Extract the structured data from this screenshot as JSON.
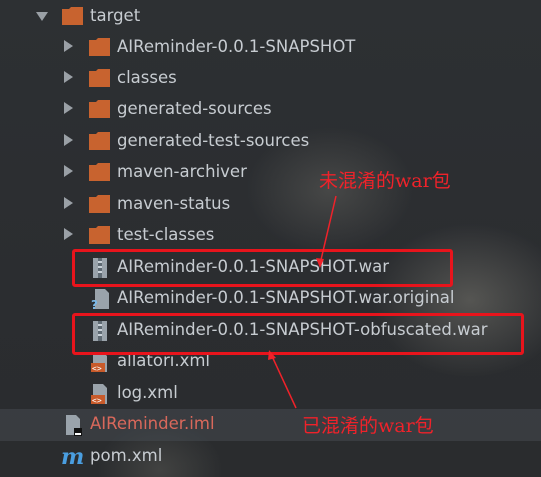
{
  "tree": {
    "items": [
      {
        "name": "target",
        "kind": "folder",
        "expander": "expanded"
      },
      {
        "name": "AIReminder-0.0.1-SNAPSHOT",
        "kind": "folder",
        "expander": "collapsed"
      },
      {
        "name": "classes",
        "kind": "folder",
        "expander": "collapsed"
      },
      {
        "name": "generated-sources",
        "kind": "folder",
        "expander": "collapsed"
      },
      {
        "name": "generated-test-sources",
        "kind": "folder",
        "expander": "collapsed"
      },
      {
        "name": "maven-archiver",
        "kind": "folder",
        "expander": "collapsed"
      },
      {
        "name": "maven-status",
        "kind": "folder",
        "expander": "collapsed"
      },
      {
        "name": "test-classes",
        "kind": "folder",
        "expander": "collapsed"
      },
      {
        "name": "AIReminder-0.0.1-SNAPSHOT.war",
        "kind": "archive-file"
      },
      {
        "name": "AIReminder-0.0.1-SNAPSHOT.war.original",
        "kind": "unknown-file"
      },
      {
        "name": "AIReminder-0.0.1-SNAPSHOT-obfuscated.war",
        "kind": "archive-file"
      },
      {
        "name": "allatori.xml",
        "kind": "xml-file"
      },
      {
        "name": "log.xml",
        "kind": "xml-file"
      },
      {
        "name": "AIReminder.iml",
        "kind": "iml-file"
      },
      {
        "name": "pom.xml",
        "kind": "maven-file"
      }
    ]
  },
  "annotations": {
    "unobfuscated_label": "未混淆的war包",
    "obfuscated_label": "已混淆的war包"
  },
  "colors": {
    "folder": "#c8632f",
    "text": "#c7ccd1",
    "iml_text": "#d9685b",
    "highlight_box": "#e8141c",
    "annotation": "#f0222a"
  }
}
